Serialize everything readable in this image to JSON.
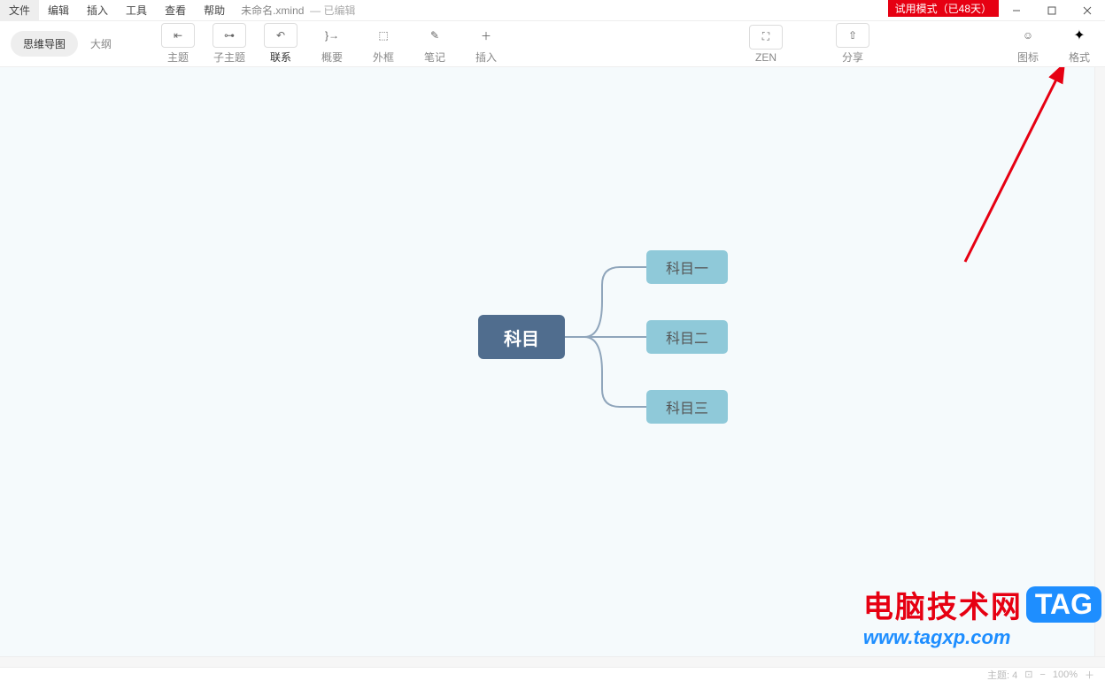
{
  "menu": {
    "file": "文件",
    "edit": "编辑",
    "insert": "插入",
    "tools": "工具",
    "view": "查看",
    "help": "帮助"
  },
  "doc": {
    "name": "未命名.xmind",
    "edited": "— 已编辑"
  },
  "trial": "试用模式（已48天）",
  "viewTabs": {
    "mindmap": "思维导图",
    "outline": "大纲"
  },
  "tools": {
    "topic": "主题",
    "subtopic": "子主题",
    "relation": "联系",
    "summary": "概要",
    "boundary": "外框",
    "note": "笔记",
    "insert": "插入",
    "zen": "ZEN",
    "share": "分享",
    "marker": "图标",
    "format": "格式"
  },
  "map": {
    "central": "科目",
    "sub1": "科目一",
    "sub2": "科目二",
    "sub3": "科目三"
  },
  "status": {
    "topicCount": "主题: 4",
    "zoom": "100%"
  },
  "watermark": {
    "cn": "电脑技术网",
    "tag": "TAG",
    "url": "www.tagxp.com"
  }
}
